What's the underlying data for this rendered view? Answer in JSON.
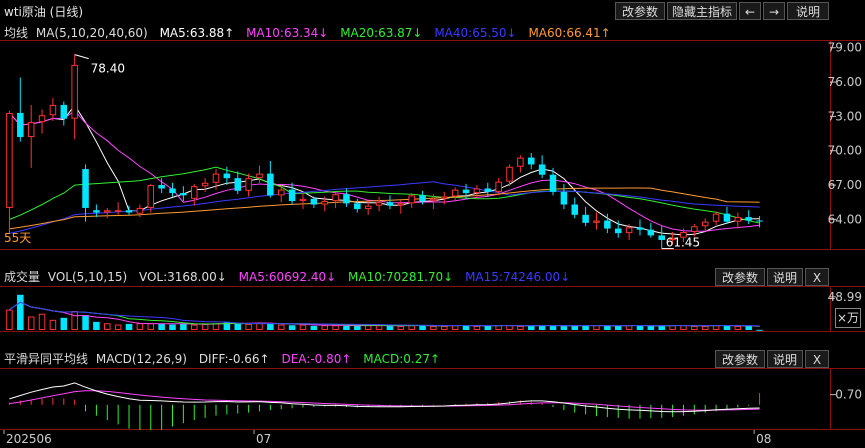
{
  "header": {
    "title": "wti原油 (日线)",
    "btn_params": "改参数",
    "btn_hide": "隐藏主指标",
    "btn_left": "←",
    "btn_right": "→",
    "btn_help": "说明"
  },
  "main_legend": {
    "name": "均线",
    "params": "MA(5,10,20,40,60)",
    "ma5": "MA5:63.88↑",
    "ma10": "MA10:63.34↓",
    "ma20": "MA20:63.87↓",
    "ma40": "MA40:65.50↓",
    "ma60": "MA60:66.41↑"
  },
  "colors": {
    "up": "#ff3232",
    "down": "#00e5ff",
    "ma5": "#ffffff",
    "ma10": "#ff44ff",
    "ma20": "#33ee33",
    "ma40": "#3a3aff",
    "ma60": "#ff9a33",
    "grid": "#8a1010"
  },
  "annotations": {
    "high": "78.40",
    "low": "61.45",
    "days": "55天"
  },
  "vol_legend": {
    "name": "成交量",
    "params": "VOL(5,10,15)",
    "vol": "VOL:3168.00↓",
    "ma5": "MA5:60692.40↓",
    "ma10": "MA10:70281.70↓",
    "ma15": "MA15:74246.00↓",
    "btn_params": "改参数",
    "btn_help": "说明",
    "btn_close": "X",
    "unit": "×万"
  },
  "macd_legend": {
    "name": "平滑异同平均线",
    "params": "MACD(12,26,9)",
    "diff": "DIFF:-0.66↑",
    "dea": "DEA:-0.80↑",
    "macd": "MACD:0.27↑",
    "btn_params": "改参数",
    "btn_help": "说明",
    "btn_close": "X"
  },
  "chart_data": [
    {
      "type": "candlestick",
      "name": "wti原油 (日线)",
      "ylim": [
        61.5,
        79.5
      ],
      "ytick_labels": [
        "79.00",
        "76.00",
        "73.00",
        "70.00",
        "67.00",
        "64.00"
      ],
      "yticks": [
        79,
        76,
        73,
        70,
        67,
        64
      ],
      "x_labels": [
        "202506",
        "07",
        "08"
      ],
      "x_label_index": [
        0,
        23,
        69
      ],
      "candles": [
        [
          65.0,
          73.5,
          62.8,
          73.3
        ],
        [
          73.3,
          76.4,
          70.8,
          71.2
        ],
        [
          71.2,
          74.0,
          68.5,
          72.5
        ],
        [
          72.5,
          73.6,
          71.5,
          73.1
        ],
        [
          73.1,
          74.6,
          72.6,
          74.0
        ],
        [
          74.0,
          74.3,
          72.2,
          72.8
        ],
        [
          72.8,
          78.4,
          71.0,
          77.5
        ],
        [
          68.4,
          68.8,
          63.8,
          65.0
        ],
        [
          64.8,
          65.3,
          64.2,
          64.6
        ],
        [
          64.6,
          65.0,
          64.1,
          64.8
        ],
        [
          64.8,
          65.5,
          64.4,
          64.8
        ],
        [
          64.8,
          65.2,
          64.4,
          64.6
        ],
        [
          64.5,
          65.3,
          64.2,
          65.0
        ],
        [
          65.0,
          67.1,
          64.6,
          67.0
        ],
        [
          67.0,
          67.6,
          66.3,
          66.7
        ],
        [
          66.7,
          67.2,
          66.0,
          66.3
        ],
        [
          66.3,
          66.9,
          65.6,
          66.1
        ],
        [
          65.8,
          67.1,
          65.2,
          66.9
        ],
        [
          66.9,
          67.6,
          66.4,
          67.2
        ],
        [
          67.2,
          68.4,
          66.6,
          68.0
        ],
        [
          68.0,
          68.6,
          67.0,
          67.6
        ],
        [
          67.6,
          68.2,
          66.2,
          66.5
        ],
        [
          66.5,
          68.0,
          66.0,
          67.6
        ],
        [
          67.6,
          68.7,
          67.2,
          68.0
        ],
        [
          68.0,
          69.1,
          65.9,
          66.1
        ],
        [
          66.1,
          67.0,
          65.5,
          66.6
        ],
        [
          66.6,
          67.2,
          65.3,
          65.6
        ],
        [
          65.6,
          66.3,
          64.9,
          65.8
        ],
        [
          65.8,
          66.0,
          65.0,
          65.3
        ],
        [
          65.3,
          66.0,
          64.7,
          65.6
        ],
        [
          65.6,
          66.4,
          65.0,
          66.2
        ],
        [
          66.2,
          66.7,
          65.1,
          65.4
        ],
        [
          65.4,
          65.8,
          64.6,
          64.9
        ],
        [
          64.9,
          65.6,
          64.4,
          65.2
        ],
        [
          65.2,
          66.0,
          64.7,
          65.5
        ],
        [
          65.5,
          66.1,
          64.9,
          65.2
        ],
        [
          65.2,
          65.7,
          64.5,
          65.4
        ],
        [
          65.4,
          66.3,
          65.0,
          66.1
        ],
        [
          66.1,
          66.5,
          65.3,
          65.6
        ],
        [
          65.6,
          66.2,
          64.9,
          65.8
        ],
        [
          65.8,
          66.4,
          65.3,
          66.0
        ],
        [
          66.0,
          66.8,
          65.6,
          66.6
        ],
        [
          66.6,
          67.1,
          65.8,
          66.3
        ],
        [
          66.3,
          67.0,
          65.9,
          66.7
        ],
        [
          66.7,
          67.2,
          66.0,
          66.4
        ],
        [
          66.4,
          67.6,
          66.1,
          67.3
        ],
        [
          67.3,
          68.8,
          66.9,
          68.6
        ],
        [
          68.6,
          69.6,
          68.1,
          69.4
        ],
        [
          69.4,
          69.8,
          68.4,
          68.8
        ],
        [
          68.8,
          69.6,
          67.6,
          67.9
        ],
        [
          67.9,
          68.5,
          66.1,
          66.4
        ],
        [
          66.4,
          67.1,
          64.9,
          65.3
        ],
        [
          65.3,
          65.9,
          64.1,
          64.4
        ],
        [
          64.4,
          65.1,
          63.4,
          63.7
        ],
        [
          63.7,
          64.6,
          63.1,
          63.9
        ],
        [
          63.9,
          64.5,
          62.8,
          63.2
        ],
        [
          63.2,
          63.9,
          62.4,
          62.8
        ],
        [
          62.8,
          63.6,
          62.2,
          63.3
        ],
        [
          63.3,
          64.0,
          62.6,
          63.1
        ],
        [
          63.1,
          63.7,
          62.4,
          62.6
        ],
        [
          62.6,
          63.4,
          61.45,
          62.2
        ],
        [
          62.2,
          62.9,
          61.8,
          62.4
        ],
        [
          62.4,
          63.2,
          62.0,
          62.9
        ],
        [
          62.9,
          63.6,
          62.5,
          63.4
        ],
        [
          63.4,
          64.1,
          63.0,
          63.8
        ],
        [
          63.8,
          64.7,
          63.5,
          64.5
        ],
        [
          64.5,
          65.1,
          63.6,
          63.8
        ],
        [
          63.8,
          64.6,
          63.2,
          64.2
        ],
        [
          64.2,
          64.8,
          63.6,
          63.9
        ],
        [
          63.9,
          64.3,
          63.3,
          63.88
        ]
      ]
    },
    {
      "type": "bar",
      "name": "VOL(5,10,15)",
      "ytick_labels": [
        "48.99"
      ],
      "yticks": [
        48.99
      ],
      "ylim": [
        0,
        62
      ],
      "values": [
        30,
        52,
        20,
        24,
        15,
        18,
        28,
        22,
        12,
        10,
        8,
        9,
        10,
        10,
        9,
        8,
        9,
        8,
        9,
        10,
        12,
        10,
        9,
        11,
        9,
        8,
        7,
        8,
        6,
        7,
        7,
        6,
        6,
        7,
        7,
        6,
        6,
        7,
        7,
        6,
        6,
        7,
        7,
        6,
        6,
        7,
        7,
        6,
        6,
        7,
        7,
        6,
        6,
        7,
        7,
        6,
        6,
        7,
        7,
        6,
        6,
        7,
        7,
        6,
        6,
        7,
        7,
        6,
        6,
        0.3
      ],
      "up": [
        1,
        0,
        1,
        1,
        1,
        0,
        1,
        0,
        0,
        1,
        1,
        0,
        1,
        1,
        0,
        0,
        0,
        1,
        1,
        1,
        0,
        0,
        1,
        1,
        0,
        1,
        0,
        1,
        0,
        1,
        1,
        0,
        0,
        1,
        1,
        0,
        1,
        1,
        0,
        1,
        1,
        1,
        0,
        1,
        0,
        1,
        1,
        1,
        0,
        0,
        0,
        0,
        0,
        0,
        1,
        0,
        0,
        1,
        0,
        0,
        0,
        1,
        1,
        1,
        1,
        1,
        0,
        1,
        0,
        0
      ]
    },
    {
      "type": "bar",
      "name": "MACD(12,26,9)",
      "ytick_labels": [
        "0.70"
      ],
      "yticks": [
        0.7
      ],
      "ylim": [
        -1.6,
        2.4
      ],
      "values": [
        0.05,
        0.1,
        0.12,
        0.14,
        0.16,
        0.15,
        0.12,
        -0.15,
        -0.25,
        -0.35,
        -0.45,
        -0.55,
        -0.6,
        -0.62,
        -0.58,
        -0.5,
        -0.42,
        -0.35,
        -0.3,
        -0.25,
        -0.22,
        -0.2,
        -0.18,
        -0.15,
        -0.12,
        -0.1,
        -0.08,
        -0.06,
        -0.05,
        -0.04,
        -0.04,
        -0.05,
        -0.06,
        -0.05,
        -0.04,
        -0.03,
        -0.03,
        -0.02,
        -0.02,
        -0.01,
        0.01,
        0.02,
        0.03,
        0.04,
        0.05,
        0.06,
        0.08,
        0.1,
        0.08,
        0.05,
        -0.05,
        -0.12,
        -0.18,
        -0.22,
        -0.26,
        -0.28,
        -0.3,
        -0.32,
        -0.32,
        -0.31,
        -0.3,
        -0.28,
        -0.25,
        -0.22,
        -0.18,
        -0.15,
        -0.1,
        -0.06,
        -0.02,
        0.27
      ]
    }
  ]
}
